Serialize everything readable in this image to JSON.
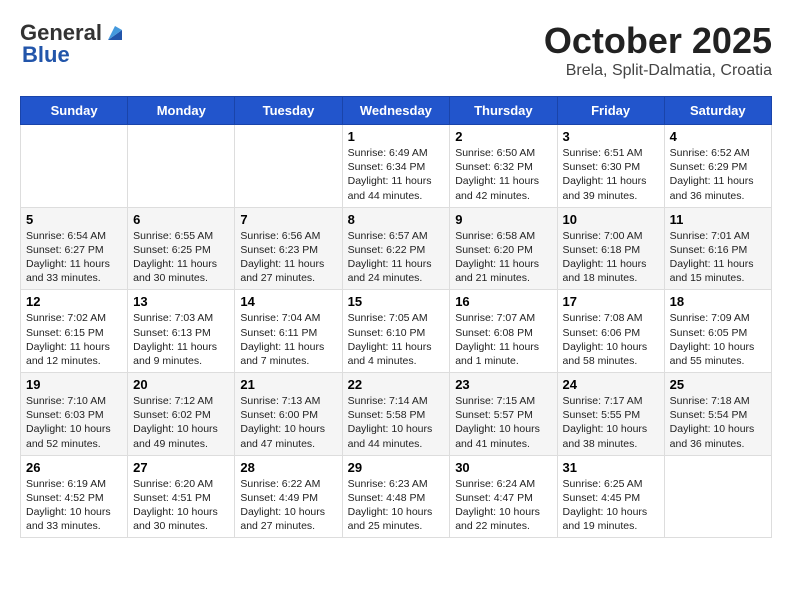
{
  "logo": {
    "general": "General",
    "blue": "Blue"
  },
  "title": "October 2025",
  "subtitle": "Brela, Split-Dalmatia, Croatia",
  "days": [
    "Sunday",
    "Monday",
    "Tuesday",
    "Wednesday",
    "Thursday",
    "Friday",
    "Saturday"
  ],
  "weeks": [
    [
      {
        "num": "",
        "text": ""
      },
      {
        "num": "",
        "text": ""
      },
      {
        "num": "",
        "text": ""
      },
      {
        "num": "1",
        "text": "Sunrise: 6:49 AM\nSunset: 6:34 PM\nDaylight: 11 hours and 44 minutes."
      },
      {
        "num": "2",
        "text": "Sunrise: 6:50 AM\nSunset: 6:32 PM\nDaylight: 11 hours and 42 minutes."
      },
      {
        "num": "3",
        "text": "Sunrise: 6:51 AM\nSunset: 6:30 PM\nDaylight: 11 hours and 39 minutes."
      },
      {
        "num": "4",
        "text": "Sunrise: 6:52 AM\nSunset: 6:29 PM\nDaylight: 11 hours and 36 minutes."
      }
    ],
    [
      {
        "num": "5",
        "text": "Sunrise: 6:54 AM\nSunset: 6:27 PM\nDaylight: 11 hours and 33 minutes."
      },
      {
        "num": "6",
        "text": "Sunrise: 6:55 AM\nSunset: 6:25 PM\nDaylight: 11 hours and 30 minutes."
      },
      {
        "num": "7",
        "text": "Sunrise: 6:56 AM\nSunset: 6:23 PM\nDaylight: 11 hours and 27 minutes."
      },
      {
        "num": "8",
        "text": "Sunrise: 6:57 AM\nSunset: 6:22 PM\nDaylight: 11 hours and 24 minutes."
      },
      {
        "num": "9",
        "text": "Sunrise: 6:58 AM\nSunset: 6:20 PM\nDaylight: 11 hours and 21 minutes."
      },
      {
        "num": "10",
        "text": "Sunrise: 7:00 AM\nSunset: 6:18 PM\nDaylight: 11 hours and 18 minutes."
      },
      {
        "num": "11",
        "text": "Sunrise: 7:01 AM\nSunset: 6:16 PM\nDaylight: 11 hours and 15 minutes."
      }
    ],
    [
      {
        "num": "12",
        "text": "Sunrise: 7:02 AM\nSunset: 6:15 PM\nDaylight: 11 hours and 12 minutes."
      },
      {
        "num": "13",
        "text": "Sunrise: 7:03 AM\nSunset: 6:13 PM\nDaylight: 11 hours and 9 minutes."
      },
      {
        "num": "14",
        "text": "Sunrise: 7:04 AM\nSunset: 6:11 PM\nDaylight: 11 hours and 7 minutes."
      },
      {
        "num": "15",
        "text": "Sunrise: 7:05 AM\nSunset: 6:10 PM\nDaylight: 11 hours and 4 minutes."
      },
      {
        "num": "16",
        "text": "Sunrise: 7:07 AM\nSunset: 6:08 PM\nDaylight: 11 hours and 1 minute."
      },
      {
        "num": "17",
        "text": "Sunrise: 7:08 AM\nSunset: 6:06 PM\nDaylight: 10 hours and 58 minutes."
      },
      {
        "num": "18",
        "text": "Sunrise: 7:09 AM\nSunset: 6:05 PM\nDaylight: 10 hours and 55 minutes."
      }
    ],
    [
      {
        "num": "19",
        "text": "Sunrise: 7:10 AM\nSunset: 6:03 PM\nDaylight: 10 hours and 52 minutes."
      },
      {
        "num": "20",
        "text": "Sunrise: 7:12 AM\nSunset: 6:02 PM\nDaylight: 10 hours and 49 minutes."
      },
      {
        "num": "21",
        "text": "Sunrise: 7:13 AM\nSunset: 6:00 PM\nDaylight: 10 hours and 47 minutes."
      },
      {
        "num": "22",
        "text": "Sunrise: 7:14 AM\nSunset: 5:58 PM\nDaylight: 10 hours and 44 minutes."
      },
      {
        "num": "23",
        "text": "Sunrise: 7:15 AM\nSunset: 5:57 PM\nDaylight: 10 hours and 41 minutes."
      },
      {
        "num": "24",
        "text": "Sunrise: 7:17 AM\nSunset: 5:55 PM\nDaylight: 10 hours and 38 minutes."
      },
      {
        "num": "25",
        "text": "Sunrise: 7:18 AM\nSunset: 5:54 PM\nDaylight: 10 hours and 36 minutes."
      }
    ],
    [
      {
        "num": "26",
        "text": "Sunrise: 6:19 AM\nSunset: 4:52 PM\nDaylight: 10 hours and 33 minutes."
      },
      {
        "num": "27",
        "text": "Sunrise: 6:20 AM\nSunset: 4:51 PM\nDaylight: 10 hours and 30 minutes."
      },
      {
        "num": "28",
        "text": "Sunrise: 6:22 AM\nSunset: 4:49 PM\nDaylight: 10 hours and 27 minutes."
      },
      {
        "num": "29",
        "text": "Sunrise: 6:23 AM\nSunset: 4:48 PM\nDaylight: 10 hours and 25 minutes."
      },
      {
        "num": "30",
        "text": "Sunrise: 6:24 AM\nSunset: 4:47 PM\nDaylight: 10 hours and 22 minutes."
      },
      {
        "num": "31",
        "text": "Sunrise: 6:25 AM\nSunset: 4:45 PM\nDaylight: 10 hours and 19 minutes."
      },
      {
        "num": "",
        "text": ""
      }
    ]
  ]
}
